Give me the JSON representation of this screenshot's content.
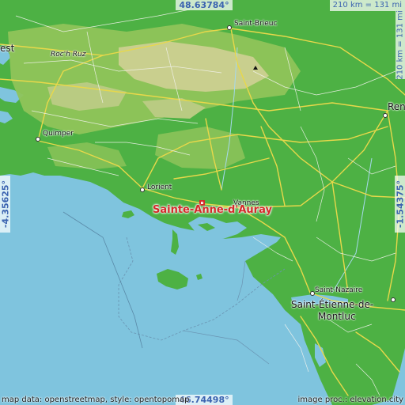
{
  "map": {
    "target_place": "Sainte-Anne-d'Auray",
    "coords": {
      "top": "48.63784°",
      "bottom": "46.74498°",
      "left": "-4.35625°",
      "right": "-1.54375°"
    },
    "scale": {
      "horizontal": "210 km = 131 mi",
      "vertical": "210 km = 131 mi"
    },
    "credits": {
      "left": "map data: openstreetmap, style: opentopomap",
      "right": "image proc.: elevation.city"
    },
    "places": {
      "brest": "est",
      "roch_ruz": "Roc'h Ruz",
      "saint_brieuc": "Saint-Brieuc",
      "rennes": "Ren",
      "quimper": "Quimper",
      "lorient": "Lorient",
      "vannes": "Vannes",
      "saint_nazaire": "Saint-Nazaire",
      "saint_etienne_line1": "Saint-Étienne-de-",
      "saint_etienne_line2": "Montluc"
    },
    "colors": {
      "sea": "#7fc4de",
      "lowland": "#4db144",
      "midland": "#8fc45a",
      "highland": "#c9cf8e",
      "marker": "#d42a2a",
      "coord_text": "#3b63b0"
    }
  }
}
